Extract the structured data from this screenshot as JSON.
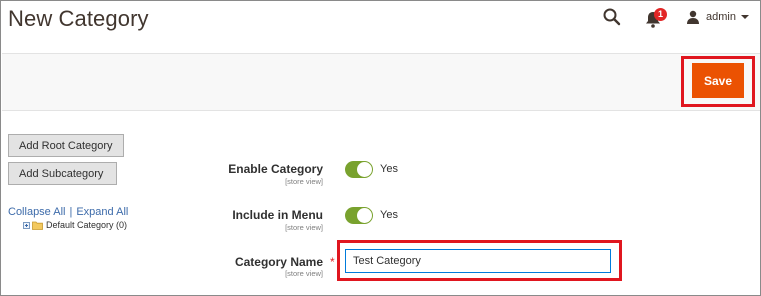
{
  "header": {
    "title": "New Category",
    "notifications_count": "1",
    "user_name": "admin"
  },
  "actions": {
    "save_label": "Save"
  },
  "tree": {
    "add_root_label": "Add Root Category",
    "add_sub_label": "Add Subcategory",
    "collapse_all": "Collapse All",
    "separator": "|",
    "expand_all": "Expand All",
    "nodes": [
      {
        "label": "Default Category (0)"
      }
    ]
  },
  "form": {
    "enable_category": {
      "label": "Enable Category",
      "scope": "[store view]",
      "state": "Yes"
    },
    "include_in_menu": {
      "label": "Include in Menu",
      "scope": "[store view]",
      "state": "Yes"
    },
    "category_name": {
      "label": "Category Name",
      "scope": "[store view]",
      "required_mark": "*",
      "value": "Test Category"
    }
  },
  "colors": {
    "accent": "#eb5202",
    "toggle_on": "#79a22e",
    "highlight": "#e0161f",
    "link": "#3d6baa"
  }
}
